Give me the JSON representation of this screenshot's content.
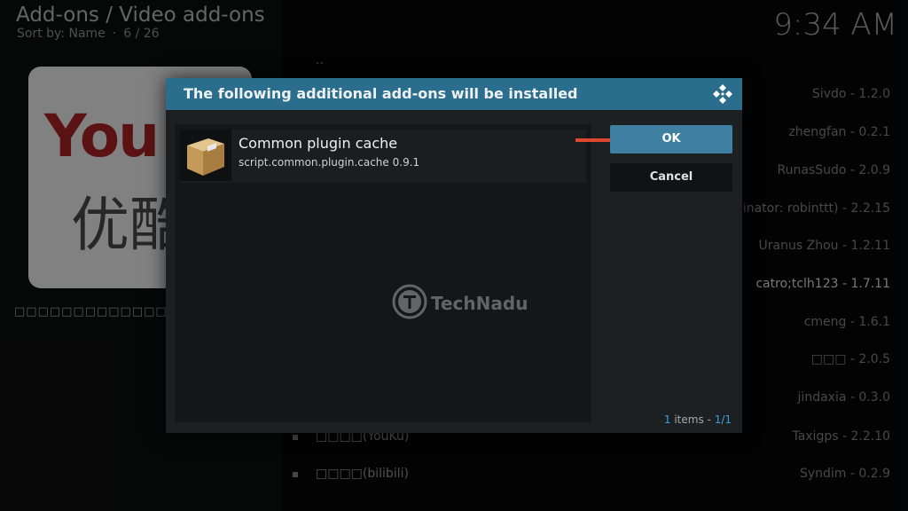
{
  "header": {
    "title": "Add-ons / Video add-ons",
    "sort_label": "Sort by: Name",
    "position": "6 / 26",
    "clock": "9:34 AM"
  },
  "thumbnail": {
    "logo_text": "You",
    "cn_text": "优酷"
  },
  "left_description": "□□□□□□□□□□□□□□□□□",
  "list": {
    "parent": "..",
    "rows": [
      {
        "version": "Sivdo - 1.2.0"
      },
      {
        "version": "zhengfan - 0.2.1"
      },
      {
        "version": "RunasSudo - 2.0.9"
      },
      {
        "version": "riginator: robinttt) - 2.2.15"
      },
      {
        "version": "Uranus Zhou - 1.2.11"
      },
      {
        "version": "catro;tclh123 - 1.7.11"
      },
      {
        "version": "cmeng - 1.6.1"
      },
      {
        "version": "□□□ - 2.0.5"
      },
      {
        "version": "jindaxia - 0.3.0"
      },
      {
        "name": "□□□□(YouKu)",
        "version": "Taxigps - 2.2.10"
      },
      {
        "name": "□□□□(bilibili)",
        "version": "Syndim - 0.2.9"
      }
    ]
  },
  "dialog": {
    "title": "The following additional add-ons will be installed",
    "item_name": "Common plugin cache",
    "item_id": "script.common.plugin.cache 0.9.1",
    "ok_label": "OK",
    "cancel_label": "Cancel",
    "count_num": "1",
    "count_text": "items -",
    "count_page": "1/1"
  },
  "watermark": {
    "text": "TechNadu"
  },
  "colors": {
    "accent": "#2b6d8c",
    "ok_button": "#3f7fa1",
    "arrow": "#e0462e",
    "count_highlight": "#3e9ed6"
  }
}
